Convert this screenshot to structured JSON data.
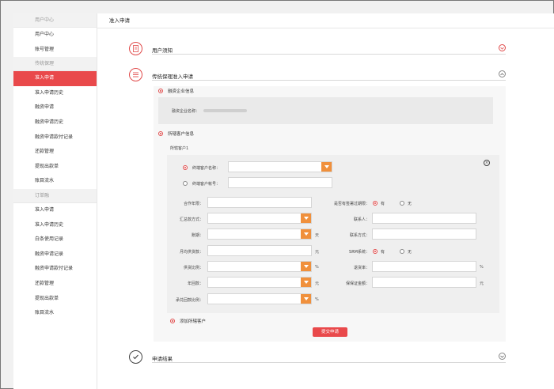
{
  "sidebar": {
    "groups": [
      {
        "label": "用户中心",
        "items": [
          "用户中心",
          "账号管理"
        ]
      },
      {
        "label": "传统保理",
        "items": [
          "准入申请",
          "准入申请历史",
          "融资申请",
          "融资申请历史",
          "融资申请款付记录",
          "还款管理",
          "提现出款单",
          "账目流水"
        ]
      },
      {
        "label": "订单融",
        "items": [
          "准入申请",
          "准入申请历史",
          "白条使用记录",
          "融资申请记录",
          "融资申请款付记录",
          "还款管理",
          "提现出款单",
          "账目流水"
        ]
      }
    ],
    "active_item": "准入申请"
  },
  "main": {
    "title": "准入申请",
    "sections": {
      "notice": "用户须知",
      "application": "传统保理准入申请",
      "result": "申请结果"
    },
    "financing_info": {
      "heading": "融资企业信息",
      "company_label": "融资企业名称："
    },
    "customer_info": {
      "heading": "所辖客户信息",
      "customer_title": "所辖客户1",
      "name_label": "终端客户名称：",
      "account_label": "终端客户帐号：",
      "left_fields": [
        "合作年限：",
        "汇总款方式：",
        "账期：",
        "月均供货款：",
        "供货比例：",
        "年回款：",
        "承兑回款比例："
      ],
      "right_fields": [
        "是否有签署过期限：",
        "联系人：",
        "联系方式：",
        "SRM系统：",
        "退货率：",
        "保保证金额："
      ],
      "units": {
        "zhang_qi": "天",
        "yuan": "元",
        "percent": "%"
      },
      "radio_yes": "有",
      "radio_no": "无"
    },
    "add_customer": "添加所辖客户",
    "submit": "提交申请"
  },
  "colors": {
    "accent": "#e9494b",
    "select_arrow": "#f0903c"
  }
}
